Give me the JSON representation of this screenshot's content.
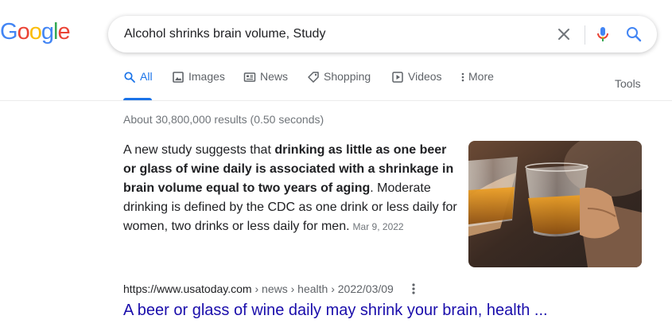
{
  "logo": {
    "letters": [
      "G",
      "o",
      "o",
      "g",
      "l",
      "e"
    ],
    "colors": [
      "#4285f4",
      "#ea4335",
      "#fbbc05",
      "#4285f4",
      "#34a853",
      "#ea4335"
    ]
  },
  "search": {
    "query": "Alcohol shrinks brain volume, Study"
  },
  "tabs": [
    {
      "label": "All",
      "icon": "search-icon",
      "active": true
    },
    {
      "label": "Images",
      "icon": "image-icon"
    },
    {
      "label": "News",
      "icon": "news-icon"
    },
    {
      "label": "Shopping",
      "icon": "tag-icon"
    },
    {
      "label": "Videos",
      "icon": "play-icon"
    },
    {
      "label": "More",
      "icon": "kebab-icon"
    }
  ],
  "tools_label": "Tools",
  "stats": "About 30,800,000 results (0.50 seconds)",
  "featured_snippet": {
    "text_before": "A new study suggests that ",
    "bold": "drinking as little as one beer or glass of wine daily is associated with a shrinkage in brain volume equal to two years of aging",
    "text_after": ". Moderate drinking is defined by the CDC as one drink or less daily for women, two drinks or less daily for men.",
    "date": "Mar 9, 2022",
    "image": "whiskey-glasses-toast"
  },
  "result": {
    "url": "https://www.usatoday.com",
    "path": " › news › health › 2022/03/09",
    "title": "A beer or glass of wine daily may shrink your brain, health ..."
  },
  "colors": {
    "accent": "#1a73e8",
    "link": "#1a0dab",
    "muted": "#70757a"
  }
}
